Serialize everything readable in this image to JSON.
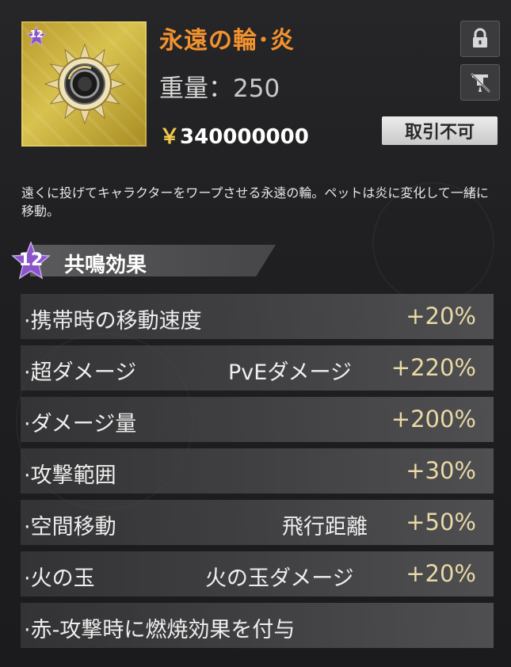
{
  "item": {
    "level_badge": "12",
    "name": "永遠の輪･炎",
    "weight_label": "重量：",
    "weight_value": "250",
    "price_currency": "￥",
    "price_amount": "340000000",
    "trade_status": "取引不可",
    "lock_icon": "lock-icon",
    "no_stack_icon": "no-pin-icon",
    "icon": "sun-ring-icon"
  },
  "description": "遠くに投げてキャラクターをワープさせる永遠の輪。ペットは炎に変化して一緒に移動。",
  "resonance": {
    "level": "12",
    "title": "共鳴効果",
    "effects": [
      {
        "label": "·携帯時の移動速度",
        "sub": "",
        "value": "+20%"
      },
      {
        "label": "·超ダメージ",
        "sub": "PvEダメージ",
        "value": "+220%"
      },
      {
        "label": "·ダメージ量",
        "sub": "",
        "value": "+200%"
      },
      {
        "label": "·攻撃範囲",
        "sub": "",
        "value": "+30%"
      },
      {
        "label": "·空間移動",
        "sub": "飛行距離",
        "value": "+50%"
      },
      {
        "label": "·火の玉",
        "sub": "火の玉ダメージ",
        "value": "+20%"
      },
      {
        "label": "·赤-攻撃時に燃焼効果を付与",
        "sub": "",
        "value": ""
      }
    ]
  },
  "colors": {
    "name": "#f2922f",
    "value": "#e8d9a6",
    "badge": "#8a55c9"
  }
}
